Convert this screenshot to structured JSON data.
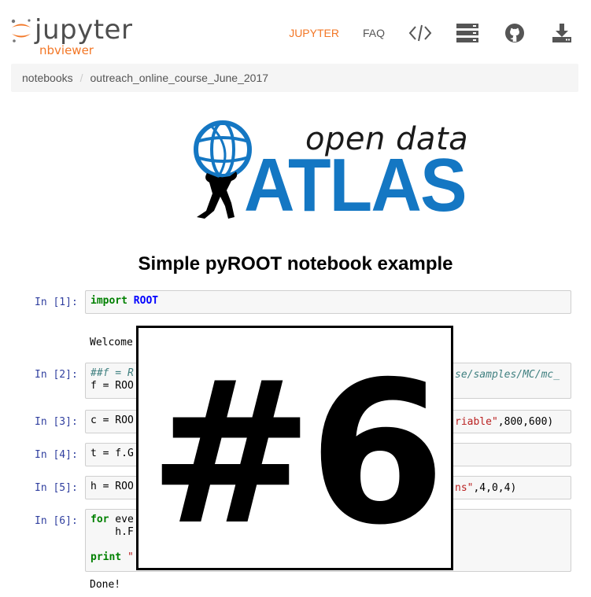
{
  "header": {
    "logo_word": "jupyter",
    "logo_sub": "nbviewer",
    "nav": [
      {
        "label": "JUPYTER",
        "active": true
      },
      {
        "label": "FAQ",
        "active": false
      }
    ],
    "icons": [
      "code-icon",
      "server-icon",
      "github-icon",
      "download-icon"
    ]
  },
  "breadcrumb": {
    "items": [
      "notebooks",
      "outreach_online_course_June_2017"
    ],
    "separator": "/"
  },
  "atlas_logo": {
    "top_text": "open data",
    "main_text": "ATLAS"
  },
  "notebook": {
    "title": "Simple pyROOT notebook example",
    "cells": [
      {
        "prompt": "In [1]:",
        "keyword": "import",
        "name": "ROOT"
      },
      {
        "output": "Welcome"
      },
      {
        "prompt": "In [2]:",
        "line1_left": "##f = R",
        "line1_right": "se/samples/MC/mc_",
        "line2": "f = ROO"
      },
      {
        "prompt": "In [3]:",
        "left": "c = ROO",
        "right_str": "riable\"",
        "right_rest": ",800,600)"
      },
      {
        "prompt": "In [4]:",
        "left": "t = f.G"
      },
      {
        "prompt": "In [5]:",
        "left": "h = ROO",
        "right_str": "ns\"",
        "right_rest": ",4,0,4)"
      },
      {
        "prompt": "In [6]:",
        "kw_for": "for",
        "line1": " eve",
        "line2": "    h.F",
        "kw_print": "print",
        "line3": " \""
      },
      {
        "output": "Done!"
      }
    ]
  },
  "overlay": {
    "text": "#6"
  },
  "colors": {
    "accent": "#f37726",
    "atlas_blue": "#1477c3",
    "prompt_blue": "#303f9f"
  }
}
